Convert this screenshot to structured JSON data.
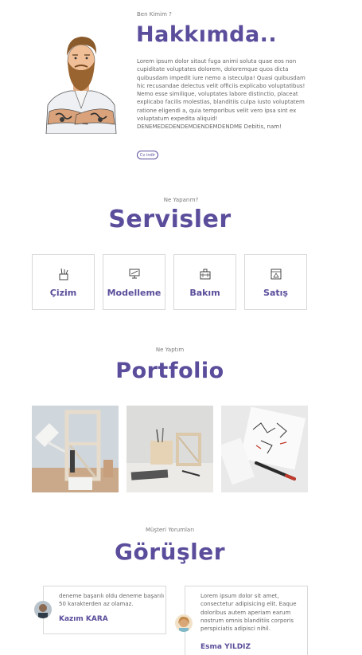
{
  "about": {
    "subtitle": "Ben Kimim ?",
    "title": "Hakkımda..",
    "text": "Lorem ipsum dolor sitaut fuga animi soluta quae eos non cupiditate voluptates dolorem, doloremque quos dicta quibusdam impedit iure nemo a isteculpa! Quasi quibusdam hic recusandae delectus velit officiis explicabo voluptatibus! Nemo esse similique, voluptates labore distinctio, placeat explicabo facilis molestias, blanditiis culpa iusto voluptatem ratione eligendi a, quia temporibus velit vero ipsa sint ex voluptatum expedita aliquid! DENEMEDEDENDEMDENDEMDENDME Debitis, nam!",
    "cv_button": "Cv indir",
    "avatar_icon": "bearded-man-illustration"
  },
  "services": {
    "subtitle": "Ne Yaparım?",
    "title": "Servisler",
    "items": [
      {
        "label": "Çizim",
        "icon": "pencil-cup-icon"
      },
      {
        "label": "Modelleme",
        "icon": "monitor-ruler-icon"
      },
      {
        "label": "Bakım",
        "icon": "toolbox-icon"
      },
      {
        "label": "Satış",
        "icon": "blueprint-sale-icon"
      }
    ]
  },
  "portfolio": {
    "subtitle": "Ne Yaptım",
    "title": "Portfolio",
    "items": [
      {
        "icon": "desk-lamp-shelf-photo"
      },
      {
        "icon": "desk-organizer-photo"
      },
      {
        "icon": "sketches-pen-photo"
      }
    ]
  },
  "reviews": {
    "subtitle": "Müşteri Yorumları",
    "title": "Görüşler",
    "items": [
      {
        "text": "deneme başarılı oldu deneme başarılı 50 karakterden az olamaz.",
        "name": "Kazım KARA",
        "avatar": "man-avatar"
      },
      {
        "text": "Lorem ipsum dolor sit amet, consectetur adipisicing elit. Eaque doloribus autem aperiam earum nostrum omnis blanditiis corporis perspiciatis adipisci nihil.",
        "name": "Esma YILDIZ",
        "avatar": "woman-avatar"
      }
    ]
  },
  "colors": {
    "accent": "#5b4d9b",
    "border": "#d9d9d9"
  }
}
